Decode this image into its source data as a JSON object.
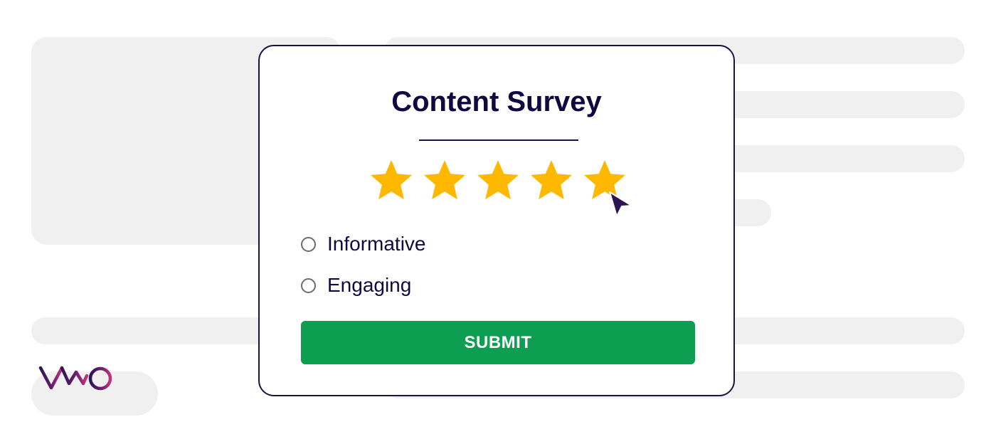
{
  "survey": {
    "title": "Content Survey",
    "rating": {
      "value": 5,
      "max": 5,
      "star_color": "#ffb800"
    },
    "options": [
      {
        "label": "Informative",
        "selected": false
      },
      {
        "label": "Engaging",
        "selected": false
      }
    ],
    "submit_label": "SUBMIT",
    "submit_color": "#0d9e52"
  },
  "brand": {
    "logo_icon": "vwo-logo-icon",
    "logo_text": "VWO"
  },
  "colors": {
    "text": "#10093f",
    "border": "#1c1044",
    "placeholder": "#f0f0f1"
  }
}
